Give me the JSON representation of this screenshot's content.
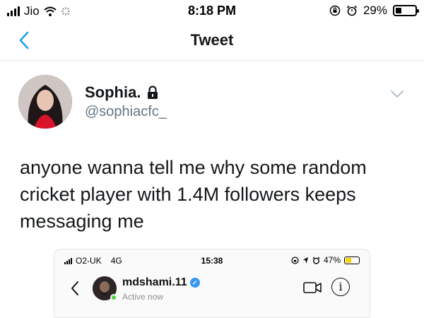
{
  "status_bar": {
    "carrier": "Jio",
    "time": "8:18 PM",
    "battery": "29%",
    "battery_level": 0.29
  },
  "nav": {
    "title": "Tweet",
    "back_icon": "chevron-left-icon"
  },
  "tweet": {
    "display_name": "Sophia.",
    "handle": "@sophiacfc_",
    "text": "anyone wanna tell me why some random cricket player with 1.4M followers keeps messaging me"
  },
  "embedded_screenshot": {
    "carrier": "O2-UK",
    "network": "4G",
    "time": "15:38",
    "battery": "47%",
    "battery_level": 0.47,
    "username": "mdshami.11",
    "status": "Active now"
  },
  "colors": {
    "accent": "#1da1f2",
    "secondary_text": "#657786",
    "verified": "#3897f0",
    "online": "#4cd137"
  }
}
